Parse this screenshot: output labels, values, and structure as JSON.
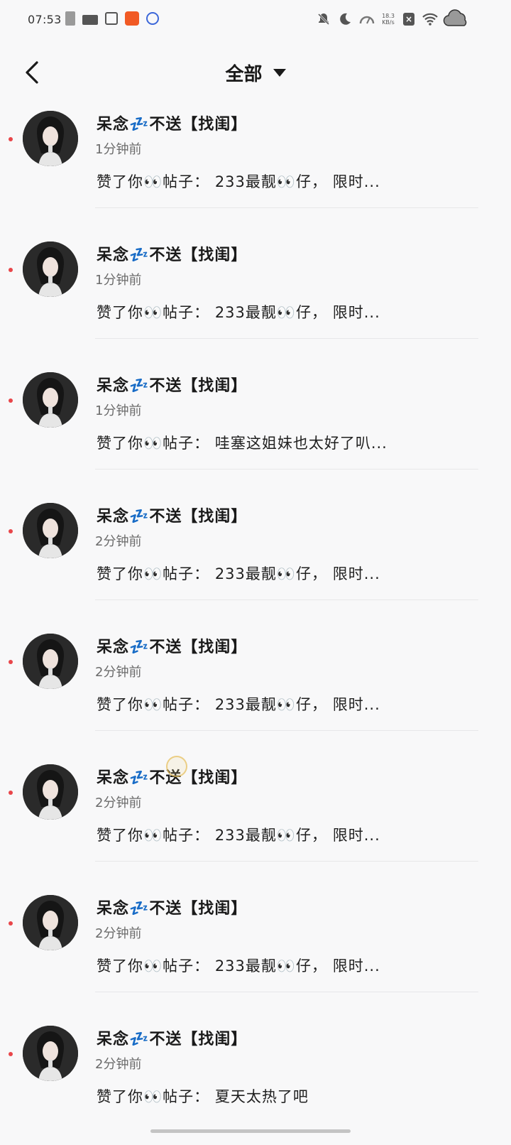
{
  "status_bar": {
    "time": "07:53",
    "left_icons": [
      "battery-icon",
      "video-icon",
      "app-box-icon",
      "orange-app-icon",
      "paw-icon"
    ],
    "right_icons": [
      "bell-off-icon",
      "moon-icon",
      "speedometer-icon",
      "xbox-icon",
      "wifi-icon",
      "cloud-icon"
    ],
    "net_speed_value": "18.3",
    "net_speed_unit": "KB/s"
  },
  "header": {
    "back_icon": "chevron-left-icon",
    "title": "全部",
    "dropdown_icon": "caret-down-icon"
  },
  "notifications": [
    {
      "name": "呆念💤不送【找闺】",
      "time": "1分钟前",
      "content": "赞了你👀帖子： 233最靓👀仔， 限时..."
    },
    {
      "name": "呆念💤不送【找闺】",
      "time": "1分钟前",
      "content": "赞了你👀帖子： 233最靓👀仔， 限时..."
    },
    {
      "name": "呆念💤不送【找闺】",
      "time": "1分钟前",
      "content": "赞了你👀帖子： 哇塞这姐妹也太好了叭..."
    },
    {
      "name": "呆念💤不送【找闺】",
      "time": "2分钟前",
      "content": "赞了你👀帖子： 233最靓👀仔， 限时..."
    },
    {
      "name": "呆念💤不送【找闺】",
      "time": "2分钟前",
      "content": "赞了你👀帖子： 233最靓👀仔， 限时..."
    },
    {
      "name": "呆念💤不送【找闺】",
      "time": "2分钟前",
      "content": "赞了你👀帖子： 233最靓👀仔， 限时..."
    },
    {
      "name": "呆念💤不送【找闺】",
      "time": "2分钟前",
      "content": "赞了你👀帖子： 233最靓👀仔， 限时..."
    },
    {
      "name": "呆念💤不送【找闺】",
      "time": "2分钟前",
      "content": "赞了你👀帖子： 夏天太热了吧"
    }
  ],
  "colors": {
    "unread_dot": "#e8464a",
    "background": "#f8f8f9",
    "divider": "#e7e7e9"
  }
}
